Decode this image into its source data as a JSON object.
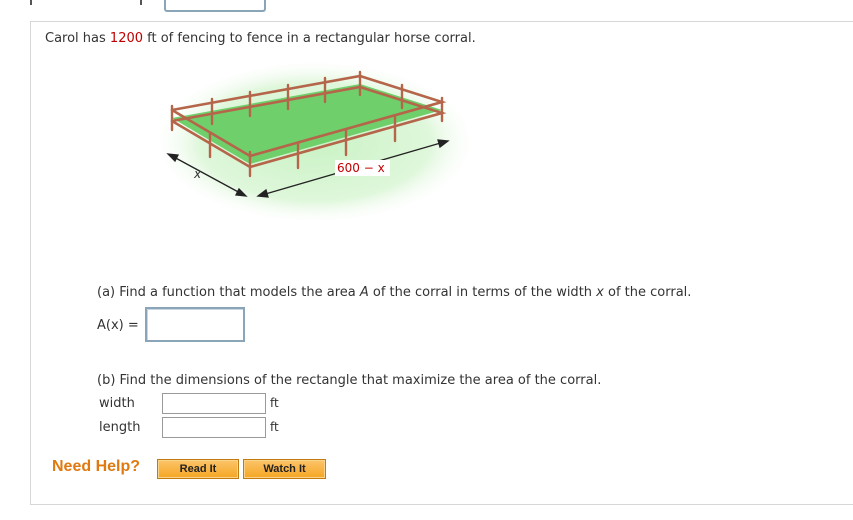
{
  "problem": {
    "intro_pre": "Carol has ",
    "intro_number": "1200",
    "intro_post": " ft of fencing to fence in a rectangular horse corral."
  },
  "figure": {
    "label_width": "x",
    "label_length": "600 − x"
  },
  "part_a": {
    "prompt_pre": "(a) Find a function that models the area ",
    "prompt_var_A": "A",
    "prompt_mid": " of the corral in terms of the width ",
    "prompt_var_x": "x",
    "prompt_post": " of the corral.",
    "function_label": "A(x) =",
    "answer_value": ""
  },
  "part_b": {
    "prompt": "(b) Find the dimensions of the rectangle that maximize the area of the corral.",
    "rows": [
      {
        "label": "width",
        "unit": "ft",
        "value": ""
      },
      {
        "label": "length",
        "unit": "ft",
        "value": ""
      }
    ]
  },
  "help": {
    "title": "Need Help?",
    "read_it": "Read It",
    "watch_it": "Watch It"
  },
  "colors": {
    "accent_red": "#c00000",
    "help_orange": "#e07a10",
    "fence": "#b5654a",
    "grass": "#6fcf6a"
  }
}
